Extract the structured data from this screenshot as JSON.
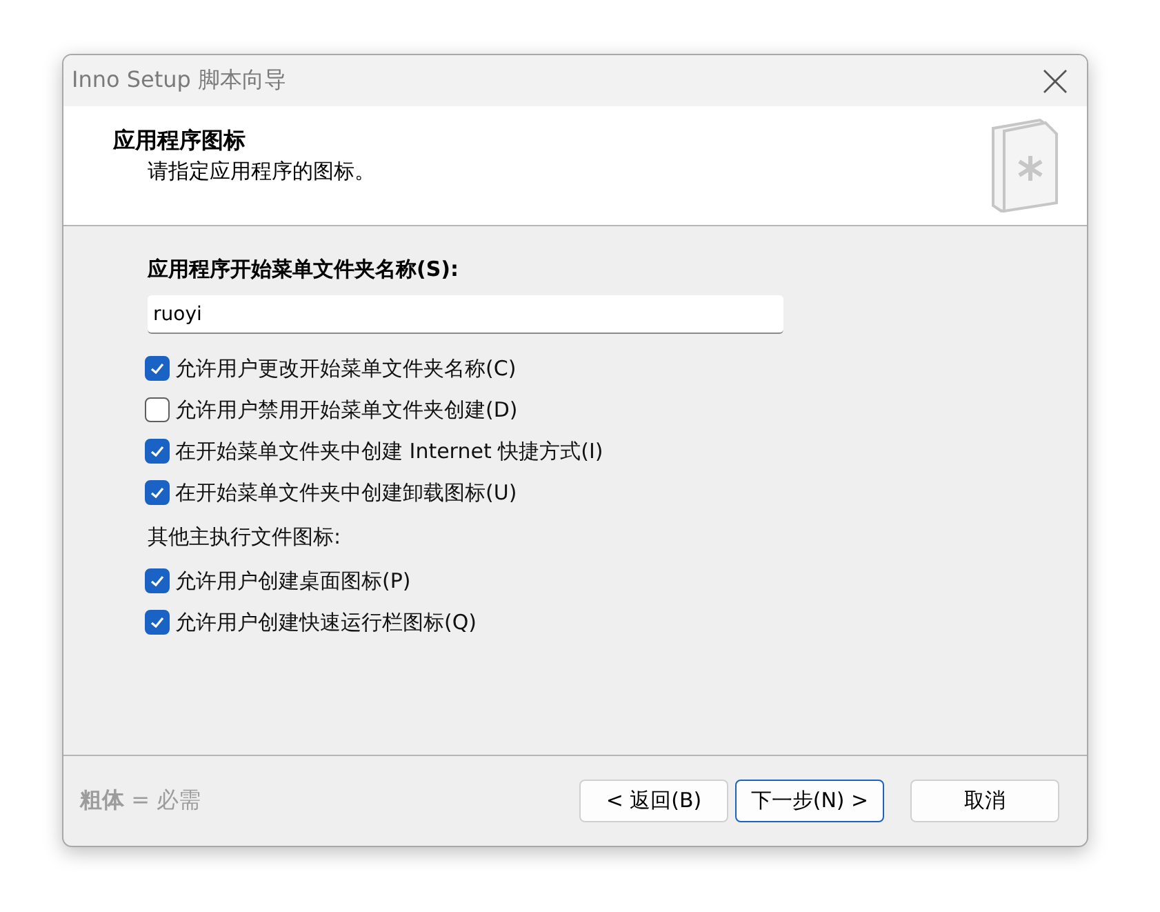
{
  "window": {
    "title": "Inno Setup 脚本向导"
  },
  "header": {
    "title": "应用程序图标",
    "subtitle": "请指定应用程序的图标。"
  },
  "folder_name": {
    "label": "应用程序开始菜单文件夹名称(S):",
    "value": "ruoyi"
  },
  "options": [
    {
      "kind": "checkbox",
      "label": "允许用户更改开始菜单文件夹名称(C)",
      "checked": true
    },
    {
      "kind": "checkbox",
      "label": "允许用户禁用开始菜单文件夹创建(D)",
      "checked": false
    },
    {
      "kind": "checkbox",
      "label": "在开始菜单文件夹中创建 Internet 快捷方式(I)",
      "checked": true
    },
    {
      "kind": "checkbox",
      "label": "在开始菜单文件夹中创建卸载图标(U)",
      "checked": true
    },
    {
      "kind": "heading",
      "label": "其他主执行文件图标:"
    },
    {
      "kind": "checkbox",
      "label": "允许用户创建桌面图标(P)",
      "checked": true
    },
    {
      "kind": "checkbox",
      "label": "允许用户创建快速运行栏图标(Q)",
      "checked": true
    }
  ],
  "footer": {
    "note": "**粗体** = 必需"
  },
  "buttons": [
    {
      "label": "< 返回(B)",
      "default": false
    },
    {
      "label": "下一步(N) >",
      "default": true
    },
    {
      "label": "取消",
      "default": false
    }
  ]
}
